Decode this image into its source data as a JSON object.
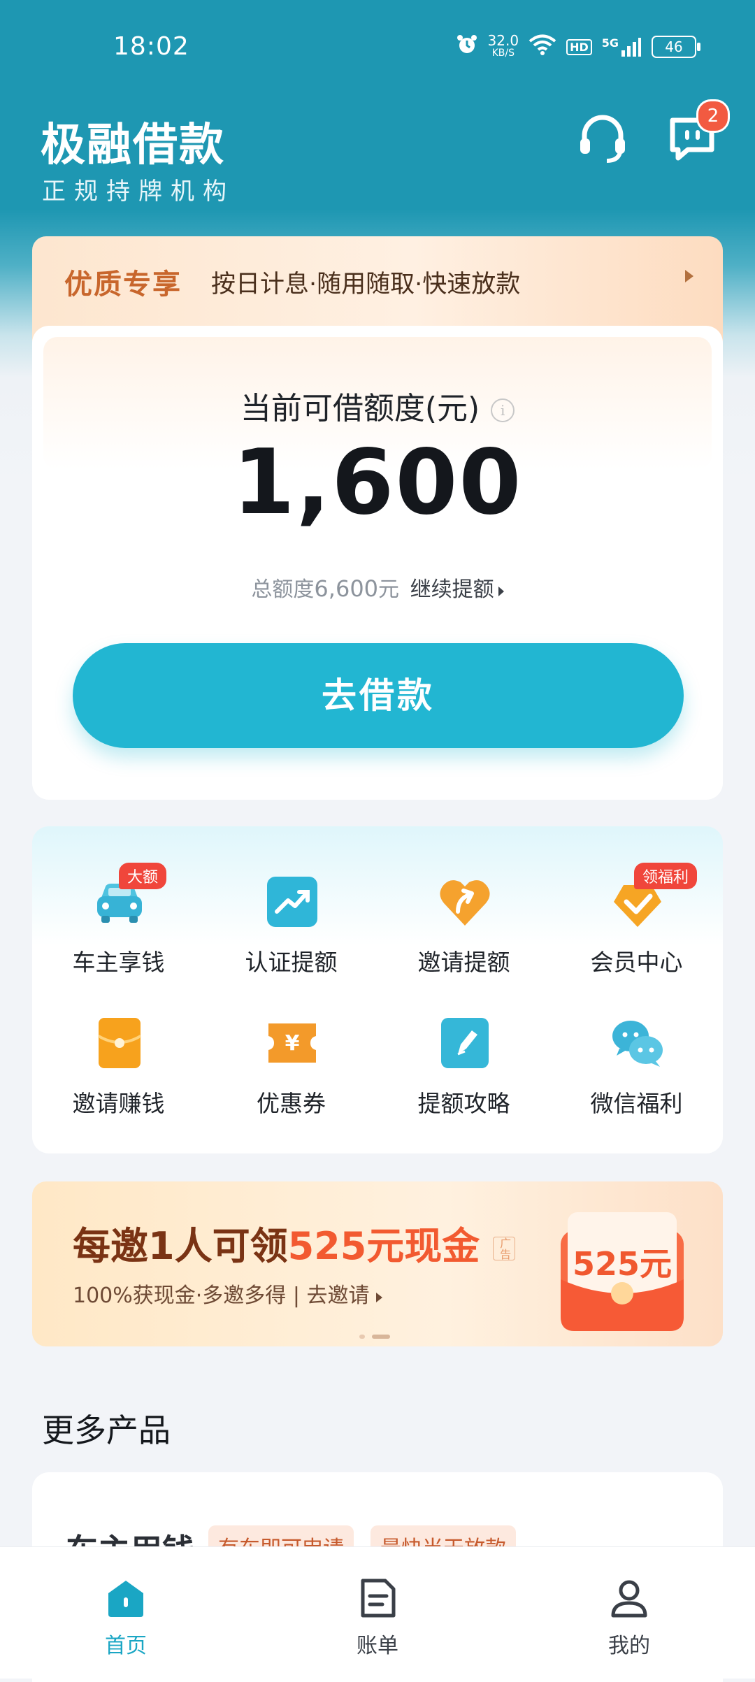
{
  "status_bar": {
    "time": "18:02",
    "net_speed": "32.0",
    "net_unit": "KB/S",
    "hd": "HD",
    "signal": "5G",
    "battery": "46"
  },
  "header": {
    "title": "极融借款",
    "subtitle": "正规持牌机构",
    "message_badge": "2"
  },
  "promo": {
    "tag": "优质专享",
    "text": "按日计息·随用随取·快速放款"
  },
  "credit": {
    "label": "当前可借额度(元)",
    "amount": "1,600",
    "total_prefix": "总额度",
    "total_value": "6,600",
    "total_suffix": "元",
    "raise_link": "继续提额",
    "borrow_button": "去借款"
  },
  "services": [
    {
      "label": "车主享钱",
      "icon": "car-icon",
      "corner": "大额"
    },
    {
      "label": "认证提额",
      "icon": "trend-up-icon"
    },
    {
      "label": "邀请提额",
      "icon": "heart-arrow-icon"
    },
    {
      "label": "会员中心",
      "icon": "member-icon",
      "corner": "领福利"
    },
    {
      "label": "邀请赚钱",
      "icon": "envelope-icon"
    },
    {
      "label": "优惠券",
      "icon": "coupon-icon",
      "symbol": "¥"
    },
    {
      "label": "提额攻略",
      "icon": "pencil-icon"
    },
    {
      "label": "微信福利",
      "icon": "wechat-icon"
    }
  ],
  "invite_banner": {
    "prefix": "每邀1人可领",
    "highlight": "525元现金",
    "small_tag": "广告",
    "subtitle": "100%获现金·多邀多得 | 去邀请",
    "packet_amount": "525元"
  },
  "more_products": {
    "title": "更多产品",
    "product_name": "车主用钱",
    "tags": [
      "有车即可申请",
      "最快当天放款"
    ]
  },
  "tabbar": [
    {
      "label": "首页",
      "icon": "home-icon",
      "active": true
    },
    {
      "label": "账单",
      "icon": "bill-icon",
      "active": false
    },
    {
      "label": "我的",
      "icon": "profile-icon",
      "active": false
    }
  ],
  "colors": {
    "header": "#1e97b2",
    "primary_button": "#22b6d2",
    "badge": "#f25a41",
    "active_tab": "#1aa6c4"
  }
}
